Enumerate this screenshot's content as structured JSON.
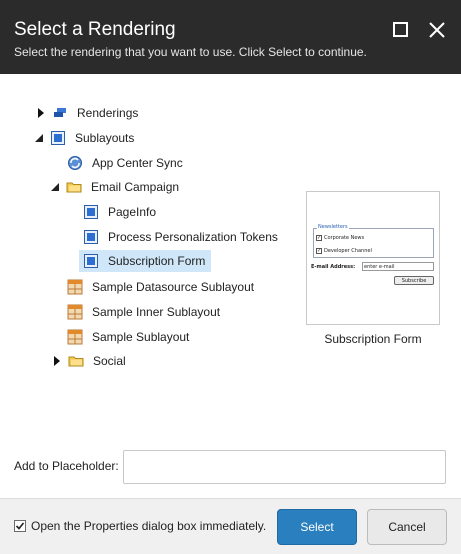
{
  "dialog": {
    "title": "Select a Rendering",
    "subtitle": "Select the rendering that you want to use. Click Select to continue."
  },
  "tree": {
    "renderings": "Renderings",
    "sublayouts": "Sublayouts",
    "app_center_sync": "App Center Sync",
    "email_campaign": "Email Campaign",
    "pageinfo": "PageInfo",
    "process_tokens": "Process Personalization Tokens",
    "subscription_form": "Subscription Form",
    "sample_datasource": "Sample Datasource Sublayout",
    "sample_inner": "Sample Inner Sublayout",
    "sample_sublayout": "Sample Sublayout",
    "social": "Social"
  },
  "preview": {
    "caption": "Subscription Form",
    "newsletters_legend": "Newsletters",
    "option1": "Corporate News",
    "option2": "Developer Channel",
    "email_label": "E-mail Address:",
    "email_value": "enter e-mail",
    "subscribe": "Subscribe"
  },
  "placeholder": {
    "label": "Add to Placeholder:",
    "value": ""
  },
  "footer": {
    "checkbox_label": "Open the Properties dialog box immediately.",
    "checkbox_checked": true,
    "select_label": "Select",
    "cancel_label": "Cancel"
  },
  "colors": {
    "header_bg": "#2b2b2b",
    "select_button": "#2a7fbe",
    "selected_row": "#cfe7f9"
  }
}
